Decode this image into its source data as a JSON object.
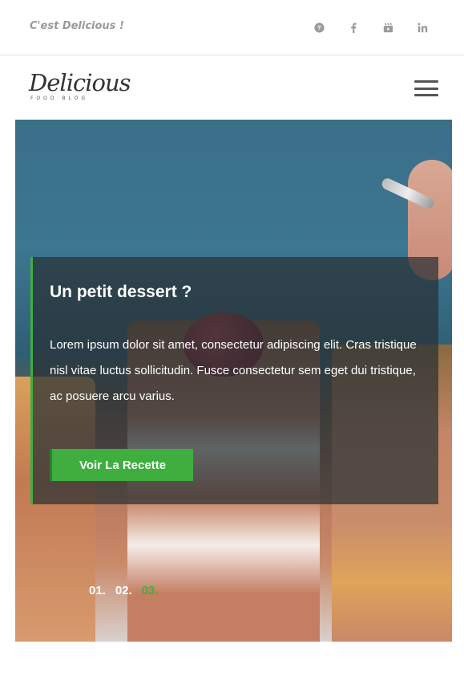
{
  "topbar": {
    "tagline": "C'est Delicious !",
    "socials": [
      {
        "icon": "pinterest-icon",
        "glyph": "P"
      },
      {
        "icon": "facebook-icon",
        "glyph": "f"
      },
      {
        "icon": "youtube-icon",
        "glyph": "▶"
      },
      {
        "icon": "linkedin-icon",
        "glyph": "in"
      }
    ]
  },
  "header": {
    "logo_main": "Delicious",
    "logo_sub": "FOOD BLOG"
  },
  "hero": {
    "title": "Un petit dessert ?",
    "text": "Lorem ipsum dolor sit amet, consectetur adipiscing elit. Cras tristique nisl vitae luctus sollicitudin. Fusce consectetur sem eget dui tristique, ac posuere arcu varius.",
    "button_label": "Voir La Recette",
    "pager": [
      "01.",
      "02.",
      "03."
    ],
    "active_page": "03."
  },
  "colors": {
    "accent": "#3fae3f",
    "overlay": "#283034",
    "muted_text": "#9a9a9a"
  }
}
